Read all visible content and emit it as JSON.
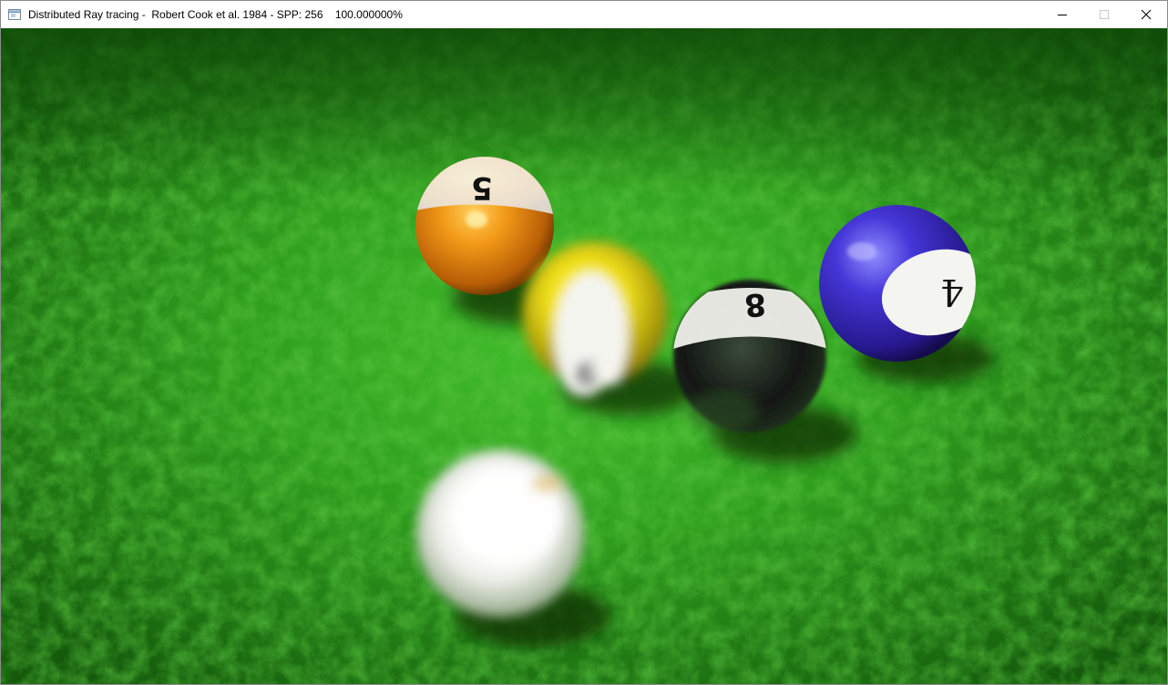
{
  "window": {
    "title": "Distributed Ray tracing -  Robert Cook et al. 1984 - SPP: 256    100.000000%",
    "app_icon": "window-app-icon",
    "controls": {
      "minimize": "minimize-icon",
      "maximize": "maximize-icon",
      "close": "close-icon"
    }
  },
  "render": {
    "felt_color": "#2f9e1e",
    "felt_dark": "#1a6a10",
    "balls": [
      {
        "name": "ball-5",
        "number": "5",
        "color": "#f08a12",
        "style": "stripe"
      },
      {
        "name": "ball-9",
        "number": "9",
        "color": "#f2e21a",
        "style": "stripe"
      },
      {
        "name": "ball-8",
        "number": "8",
        "color": "#151515",
        "style": "solid"
      },
      {
        "name": "ball-4",
        "number": "4",
        "color": "#3226b8",
        "style": "solid"
      },
      {
        "name": "cue-ball",
        "number": "",
        "color": "#f4f4f0",
        "style": "cue"
      }
    ]
  }
}
